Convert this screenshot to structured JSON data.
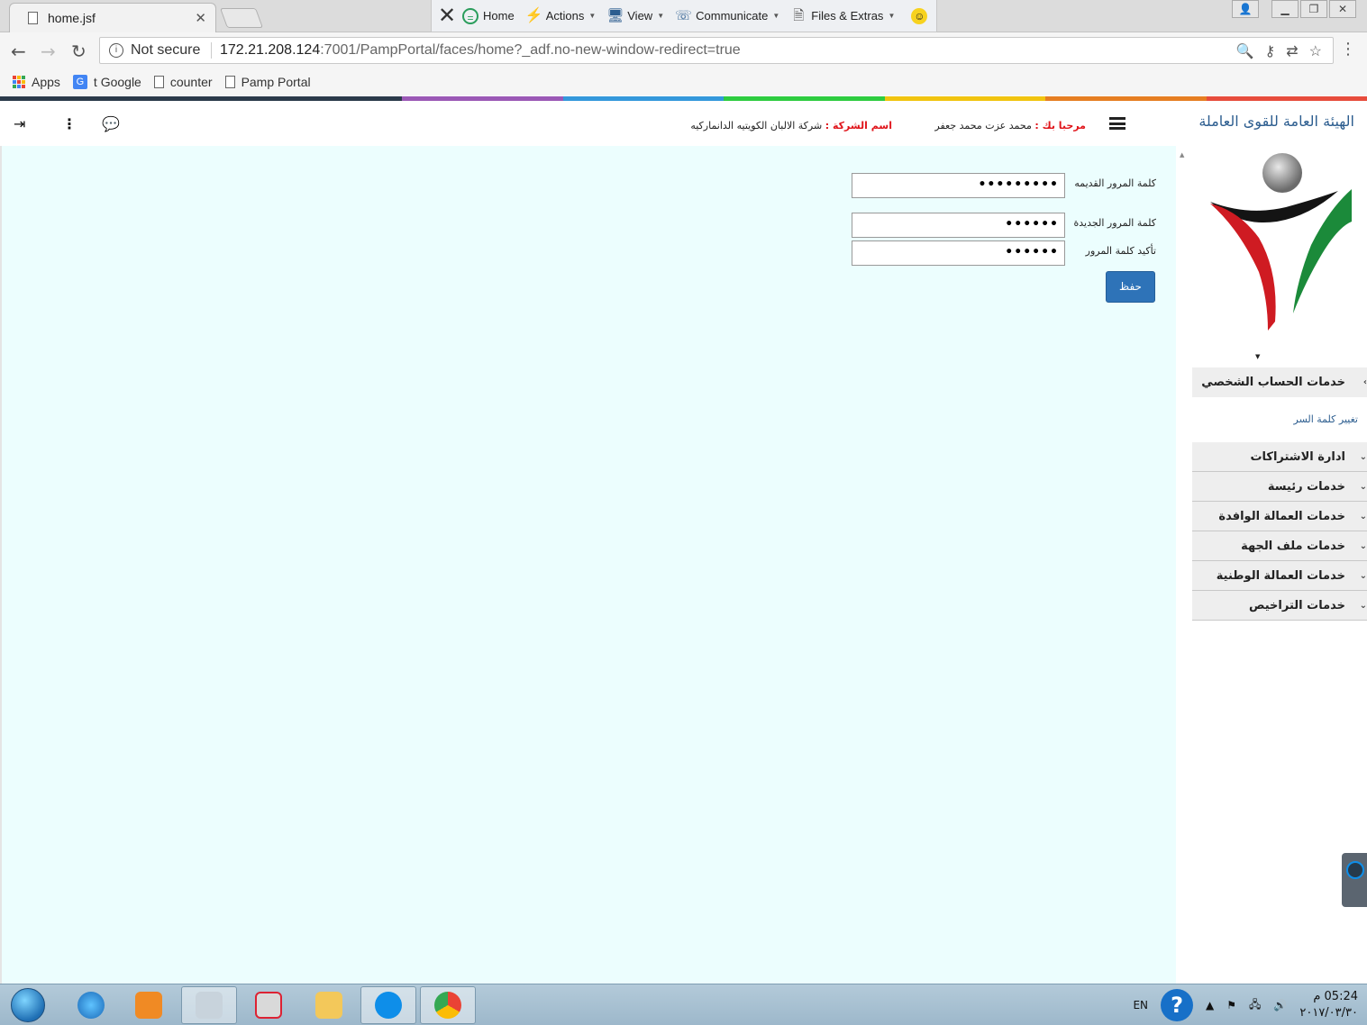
{
  "browser": {
    "tab_title": "home.jsf",
    "address": {
      "security_label": "Not secure",
      "url_host": "172.21.208.124",
      "url_rest": ":7001/PampPortal/faces/home?_adf.no-new-window-redirect=true"
    },
    "bookmarks": [
      "Apps",
      "t Google",
      "counter",
      "Pamp Portal"
    ]
  },
  "teamviewer": {
    "items": [
      "Home",
      "Actions",
      "View",
      "Communicate",
      "Files & Extras"
    ]
  },
  "header": {
    "org_name": "الهيئة العامة للقوى العاملة",
    "welcome_label": "مرحبا بك :",
    "welcome_user": "محمد عزت محمد جعفر",
    "company_label": "اسم الشركة :",
    "company_name": "شركة الالبان الكويتيه الدانماركيه"
  },
  "form": {
    "old_password_label": "كلمة المرور القديمه",
    "old_password_value": "•••••••••",
    "new_password_label": "كلمة المرور الجديدة",
    "new_password_value": "••••••",
    "confirm_password_label": "تأكيد كلمة المرور",
    "confirm_password_value": "••••••",
    "save_label": "حفظ"
  },
  "sidebar": {
    "open_section": "خدمات الحساب الشخصي",
    "open_section_link": "تغيير كلمة السر",
    "sections": [
      "ادارة الاشتراكات",
      "خدمات رئيسة",
      "خدمات العمالة الوافدة",
      "خدمات ملف الجهة",
      "خدمات العمالة الوطنية",
      "خدمات التراخيص"
    ]
  },
  "taskbar": {
    "language": "EN",
    "time": "05:24 م",
    "date": "٢٠١٧/٠٣/٣٠"
  },
  "colors": {
    "accent_blue": "#2e73b8",
    "content_bg": "#ecfefe",
    "label_red": "#e0151b",
    "strip": [
      "#2b3a4a",
      "#9b59b6",
      "#3498db",
      "#2ecc40",
      "#f1c40f",
      "#e67e22",
      "#e74c3c"
    ]
  }
}
